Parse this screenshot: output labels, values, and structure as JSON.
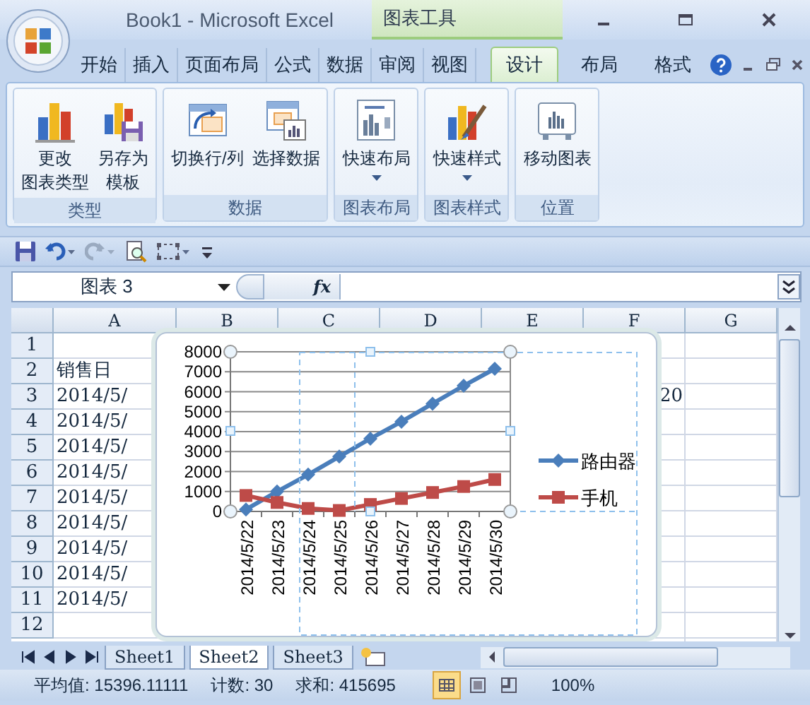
{
  "window": {
    "title": "Book1 - Microsoft Excel",
    "context_title": "图表工具"
  },
  "tabs": [
    {
      "label": "开始",
      "selected": false,
      "kind": "standard"
    },
    {
      "label": "插入",
      "selected": false,
      "kind": "standard"
    },
    {
      "label": "页面布局",
      "selected": false,
      "kind": "standard"
    },
    {
      "label": "公式",
      "selected": false,
      "kind": "standard"
    },
    {
      "label": "数据",
      "selected": false,
      "kind": "standard"
    },
    {
      "label": "审阅",
      "selected": false,
      "kind": "standard"
    },
    {
      "label": "视图",
      "selected": false,
      "kind": "standard"
    },
    {
      "label": "设计",
      "selected": true,
      "kind": "context"
    },
    {
      "label": "布局",
      "selected": false,
      "kind": "context"
    },
    {
      "label": "格式",
      "selected": false,
      "kind": "context"
    }
  ],
  "ribbon_groups": [
    {
      "label": "类型",
      "buttons": [
        {
          "lines": [
            "更改",
            "图表类型"
          ],
          "dropdown": false
        },
        {
          "lines": [
            "另存为",
            "模板"
          ],
          "dropdown": false
        }
      ]
    },
    {
      "label": "数据",
      "buttons": [
        {
          "lines": [
            "切换行/列"
          ],
          "dropdown": false
        },
        {
          "lines": [
            "选择数据"
          ],
          "dropdown": false
        }
      ]
    },
    {
      "label": "图表布局",
      "buttons": [
        {
          "lines": [
            "快速布局"
          ],
          "dropdown": true
        }
      ]
    },
    {
      "label": "图表样式",
      "buttons": [
        {
          "lines": [
            "快速样式"
          ],
          "dropdown": true
        }
      ]
    },
    {
      "label": "位置",
      "buttons": [
        {
          "lines": [
            "移动图表"
          ],
          "dropdown": false
        }
      ]
    }
  ],
  "formula_bar": {
    "name_box": "图表 3",
    "function_label": "fx"
  },
  "columns": [
    "A",
    "B",
    "C",
    "D",
    "E",
    "F",
    "G"
  ],
  "rows": [
    {
      "header": "1"
    },
    {
      "header": "2",
      "a": "销售日"
    },
    {
      "header": "3",
      "a": "2014/5/",
      "f": "20"
    },
    {
      "header": "4",
      "a": "2014/5/"
    },
    {
      "header": "5",
      "a": "2014/5/"
    },
    {
      "header": "6",
      "a": "2014/5/"
    },
    {
      "header": "7",
      "a": "2014/5/"
    },
    {
      "header": "8",
      "a": "2014/5/"
    },
    {
      "header": "9",
      "a": "2014/5/"
    },
    {
      "header": "10",
      "a": "2014/5/"
    },
    {
      "header": "11",
      "a": "2014/5/"
    },
    {
      "header": "12"
    }
  ],
  "chart": {
    "chart_data": {
      "type": "line",
      "categories": [
        "2014/5/22",
        "2014/5/23",
        "2014/5/24",
        "2014/5/25",
        "2014/5/26",
        "2014/5/27",
        "2014/5/28",
        "2014/5/29",
        "2014/5/30"
      ],
      "series": [
        {
          "name": "路由器",
          "color": "#4a7ebb",
          "marker": "diamond",
          "values": [
            100,
            1000,
            1850,
            2750,
            3650,
            4500,
            5400,
            6300,
            7150
          ]
        },
        {
          "name": "手机",
          "color": "#be4b48",
          "marker": "square",
          "values": [
            800,
            450,
            150,
            50,
            350,
            650,
            950,
            1250,
            1600
          ]
        }
      ],
      "grid": true,
      "legend": "right",
      "ylim": [
        0,
        8000
      ],
      "yticks": [
        0,
        1000,
        2000,
        3000,
        4000,
        5000,
        6000,
        7000,
        8000
      ]
    }
  },
  "sheet_tabs": [
    {
      "label": "Sheet1",
      "selected": false
    },
    {
      "label": "Sheet2",
      "selected": true
    },
    {
      "label": "Sheet3",
      "selected": false
    }
  ],
  "status_bar": {
    "items": [
      "平均值: 15396.11111",
      "计数: 30",
      "求和: 415695"
    ],
    "view_buttons": [
      {
        "selected": true
      },
      {
        "selected": false
      },
      {
        "selected": false
      }
    ],
    "zoom": "100%"
  }
}
